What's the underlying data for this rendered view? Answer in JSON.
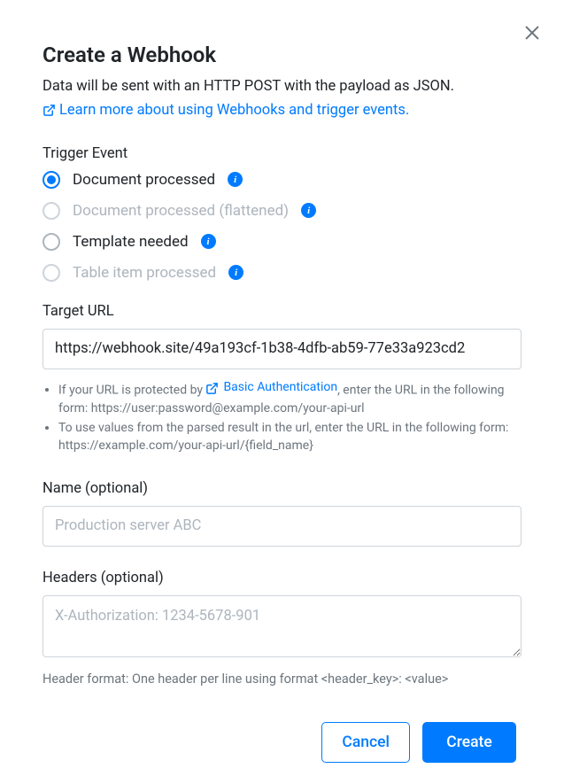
{
  "header": {
    "title": "Create a Webhook",
    "subtitle": "Data will be sent with an HTTP POST with the payload as JSON.",
    "learn_link": "Learn more about using Webhooks and trigger events."
  },
  "trigger": {
    "label": "Trigger Event",
    "options": [
      {
        "label": "Document processed",
        "selected": true,
        "disabled": false
      },
      {
        "label": "Document processed (flattened)",
        "selected": false,
        "disabled": true
      },
      {
        "label": "Template needed",
        "selected": false,
        "disabled": false
      },
      {
        "label": "Table item processed",
        "selected": false,
        "disabled": true
      }
    ]
  },
  "target_url": {
    "label": "Target URL",
    "value": "https://webhook.site/49a193cf-1b38-4dfb-ab59-77e33a923cd2",
    "hints": {
      "h1a": "If your URL is protected by ",
      "h1link": "Basic Authentication",
      "h1b": ", enter the URL in the following form: https://user:password@example.com/your-api-url",
      "h2": "To use values from the parsed result in the url, enter the URL in the following form: https://example.com/your-api-url/{field_name}"
    }
  },
  "name_field": {
    "label": "Name (optional)",
    "placeholder": "Production server ABC",
    "value": ""
  },
  "headers_field": {
    "label": "Headers (optional)",
    "placeholder": "X-Authorization: 1234-5678-901",
    "value": "",
    "hint": "Header format: One header per line using format <header_key>: <value>"
  },
  "footer": {
    "cancel": "Cancel",
    "create": "Create"
  },
  "glyph": {
    "info": "i"
  }
}
